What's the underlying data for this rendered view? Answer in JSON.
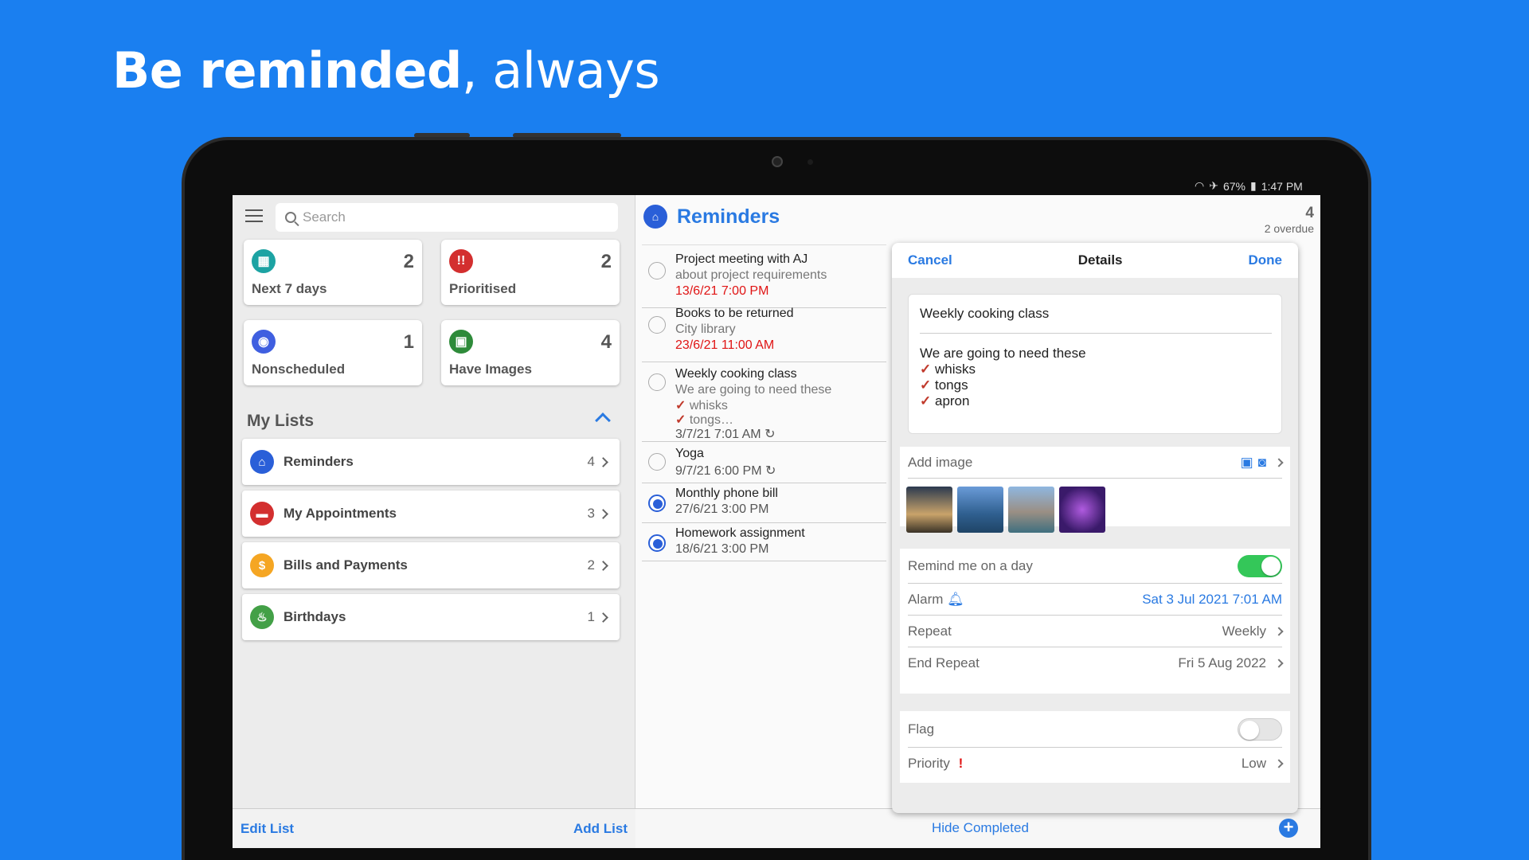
{
  "headline": {
    "bold": "Be reminded",
    "rest": ", always"
  },
  "status_bar": {
    "battery": "67%",
    "time": "1:47 PM"
  },
  "sidebar": {
    "search_placeholder": "Search",
    "smart_lists": [
      {
        "label": "Next 7 days",
        "count": "2",
        "icon": "calendar-icon",
        "color": "#1ca3a3"
      },
      {
        "label": "Prioritised",
        "count": "2",
        "icon": "exclamation-icon",
        "color": "#d32f2f"
      },
      {
        "label": "Nonscheduled",
        "count": "1",
        "icon": "target-icon",
        "color": "#3f5fe0"
      },
      {
        "label": "Have Images",
        "count": "4",
        "icon": "image-icon",
        "color": "#2e8b3a"
      }
    ],
    "my_lists_title": "My Lists",
    "lists": [
      {
        "label": "Reminders",
        "count": "4",
        "icon": "bank-icon",
        "color": "#2a5fd8"
      },
      {
        "label": "My Appointments",
        "count": "3",
        "icon": "car-icon",
        "color": "#d32f2f"
      },
      {
        "label": "Bills and Payments",
        "count": "2",
        "icon": "dollar-icon",
        "color": "#f5a623"
      },
      {
        "label": "Birthdays",
        "count": "1",
        "icon": "cake-icon",
        "color": "#43a047"
      }
    ],
    "edit_list": "Edit List",
    "add_list": "Add List"
  },
  "reminders": {
    "title": "Reminders",
    "count": "4",
    "overdue": "2 overdue",
    "items": [
      {
        "title": "Project meeting with AJ",
        "sub": "about project requirements",
        "date": "13/6/21 7:00 PM",
        "overdue": true,
        "done": false
      },
      {
        "title": "Books to be returned",
        "sub": "City library",
        "date": "23/6/21 11:00 AM",
        "overdue": true,
        "done": false
      },
      {
        "title": "Weekly cooking class",
        "sub": "We are going  to need these",
        "sub2": "whisks",
        "sub3": "tongs…",
        "date": "3/7/21 7:01 AM",
        "repeat": true,
        "done": false
      },
      {
        "title": "Yoga",
        "date": "9/7/21 6:00 PM",
        "repeat": true,
        "done": false
      },
      {
        "title": "Monthly phone bill",
        "date": "27/6/21 3:00 PM",
        "done": true
      },
      {
        "title": "Homework assignment",
        "date": "18/6/21 3:00 PM",
        "done": true
      }
    ],
    "hide_completed": "Hide Completed"
  },
  "details": {
    "cancel": "Cancel",
    "title": "Details",
    "done": "Done",
    "note_title": "Weekly cooking class",
    "note_body": "We are going  to need these",
    "note_items": [
      "whisks",
      "tongs",
      "apron"
    ],
    "add_image": "Add image",
    "remind_on_day": "Remind me on a day",
    "remind_on_day_on": true,
    "alarm_label": "Alarm",
    "alarm_value": "Sat 3 Jul 2021 7:01 AM",
    "repeat_label": "Repeat",
    "repeat_value": "Weekly",
    "end_repeat_label": "End Repeat",
    "end_repeat_value": "Fri 5 Aug 2022",
    "flag_label": "Flag",
    "flag_on": false,
    "priority_label": "Priority",
    "priority_value": "Low"
  }
}
